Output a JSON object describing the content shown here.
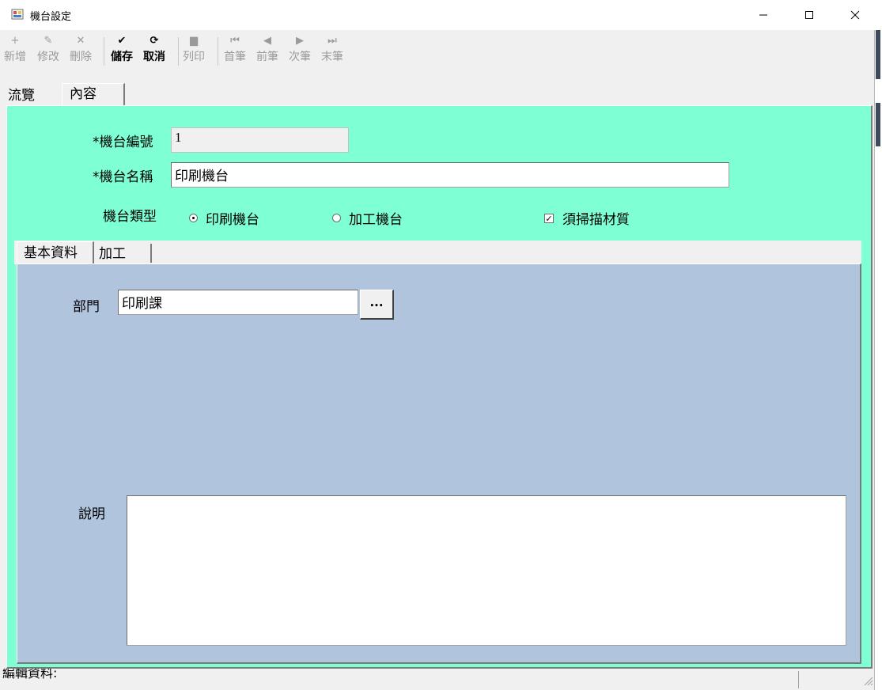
{
  "window": {
    "title": "機台設定"
  },
  "toolbar": {
    "items": [
      {
        "label": "新增",
        "icon": "plus-icon",
        "glyph": "+"
      },
      {
        "label": "修改",
        "icon": "pencil-icon",
        "glyph": "✎"
      },
      {
        "label": "刪除",
        "icon": "delete-icon",
        "glyph": "✕"
      },
      {
        "label": "儲存",
        "icon": "check-icon",
        "glyph": "✔"
      },
      {
        "label": "取消",
        "icon": "undo-icon",
        "glyph": "⟳"
      },
      {
        "label": "列印",
        "icon": "print-icon",
        "glyph": "▆"
      },
      {
        "label": "首筆",
        "icon": "first-record-icon",
        "glyph": "⏮"
      },
      {
        "label": "前筆",
        "icon": "prev-record-icon",
        "glyph": "◀"
      },
      {
        "label": "次筆",
        "icon": "next-record-icon",
        "glyph": "▶"
      },
      {
        "label": "末筆",
        "icon": "last-record-icon",
        "glyph": "⏭"
      }
    ]
  },
  "tabs": {
    "browse": "流覽",
    "content": "內容"
  },
  "form": {
    "machine_no_label": "*機台編號",
    "machine_no_value": "1",
    "machine_name_label": "*機台名稱",
    "machine_name_value": "印刷機台",
    "machine_type_label": "機台類型",
    "type_print": "印刷機台",
    "type_process": "加工機台",
    "scan_material": "須掃描材質",
    "selected_type": "印刷機台",
    "scan_checked": true
  },
  "inner_tabs": {
    "basic": "基本資料",
    "process": "加工"
  },
  "basic": {
    "dept_label": "部門",
    "dept_value": "印刷課",
    "browse_button": "...",
    "desc_label": "說明",
    "desc_value": ""
  },
  "status": {
    "text": "編輯資料:"
  },
  "colors": {
    "panel": "#7fffd4",
    "inner_panel": "#b0c4de"
  }
}
